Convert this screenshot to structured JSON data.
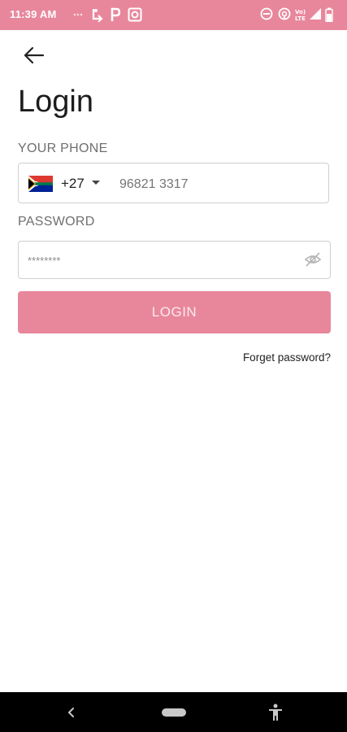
{
  "status_bar": {
    "time": "11:39 AM",
    "background_color": "#e8879c",
    "icons": [
      "notification-dots-icon",
      "call-forward-icon",
      "parking-icon",
      "screen-capture-icon",
      "do-not-disturb-icon",
      "hotspot-icon",
      "volte-signal-icon",
      "signal-icon",
      "battery-icon"
    ]
  },
  "header": {
    "back_icon": "arrow-left-icon",
    "title": "Login"
  },
  "phone": {
    "label": "YOUR PHONE",
    "country_flag": "south-africa-flag-icon",
    "dial_code": "+27",
    "dropdown_icon": "caret-down-icon",
    "placeholder": "96821 3317"
  },
  "password": {
    "label": "PASSWORD",
    "value": "********",
    "visibility_icon": "eye-off-icon"
  },
  "login_button": {
    "label": "LOGIN",
    "color": "#e8879c"
  },
  "forget_password": {
    "label": "Forget password?"
  },
  "nav_bar": {
    "icons": [
      "nav-back-icon",
      "nav-home-pill",
      "accessibility-icon"
    ]
  }
}
